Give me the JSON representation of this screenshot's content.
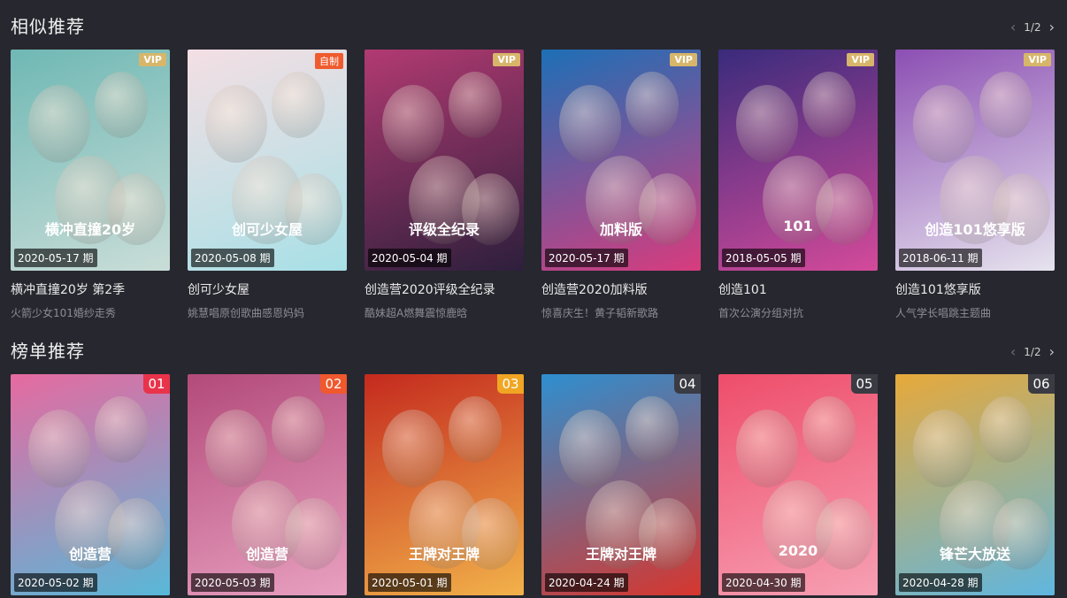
{
  "similar": {
    "title": "相似推荐",
    "pager": "1/2",
    "items": [
      {
        "title": "横冲直撞20岁 第2季",
        "desc": "火箭少女101婚纱走秀",
        "date": "2020-05-17 期",
        "badge": "VIP",
        "badge_type": "vip",
        "bg": "#6fb8b4",
        "bg2": "#c9ddd8",
        "art_text": "横冲直撞20岁"
      },
      {
        "title": "创可少女屋",
        "desc": "姚慧唱原创歌曲感恩妈妈",
        "date": "2020-05-08 期",
        "badge": "自制",
        "badge_type": "self",
        "bg": "#f4dfe4",
        "bg2": "#a7e0e6",
        "art_text": "创可少女屋"
      },
      {
        "title": "创造营2020评级全纪录",
        "desc": "酷妹超A燃舞震惊鹿晗",
        "date": "2020-05-04 期",
        "badge": "VIP",
        "badge_type": "vip",
        "bg": "#b23a72",
        "bg2": "#2d1f3c",
        "art_text": "评级全纪录"
      },
      {
        "title": "创造营2020加料版",
        "desc": "惊喜庆生！黄子韬新歌路",
        "date": "2020-05-17 期",
        "badge": "VIP",
        "badge_type": "vip",
        "bg": "#1d6fb6",
        "bg2": "#d83c7e",
        "art_text": "加料版"
      },
      {
        "title": "创造101",
        "desc": "首次公演分组对抗",
        "date": "2018-05-05 期",
        "badge": "VIP",
        "badge_type": "vip",
        "bg": "#3a2b7c",
        "bg2": "#d44a9a",
        "art_text": "101"
      },
      {
        "title": "创造101悠享版",
        "desc": "人气学长唱跳主题曲",
        "date": "2018-06-11 期",
        "badge": "VIP",
        "badge_type": "vip",
        "bg": "#8c4fb3",
        "bg2": "#e6e3ee",
        "art_text": "创造101悠享版"
      }
    ]
  },
  "ranking": {
    "title": "榜单推荐",
    "pager": "1/2",
    "items": [
      {
        "rank": "01",
        "date": "2020-05-02 期",
        "rank_color": "#e8334a",
        "bg": "#e66aa0",
        "bg2": "#58b8d8",
        "art_text": "创造营"
      },
      {
        "rank": "02",
        "date": "2020-05-03 期",
        "rank_color": "#f0582e",
        "bg": "#b34a7a",
        "bg2": "#e8a0c0",
        "art_text": "创造营"
      },
      {
        "rank": "03",
        "date": "2020-05-01 期",
        "rank_color": "#f0a623",
        "bg": "#c42a1e",
        "bg2": "#f2b24a",
        "art_text": "王牌对王牌"
      },
      {
        "rank": "04",
        "date": "2020-04-24 期",
        "rank_color": "#3b3b43",
        "bg": "#2e8fd0",
        "bg2": "#d7362e",
        "art_text": "王牌对王牌"
      },
      {
        "rank": "05",
        "date": "2020-04-30 期",
        "rank_color": "#3b3b43",
        "bg": "#ee4d6a",
        "bg2": "#f7a0b4",
        "art_text": "2020"
      },
      {
        "rank": "06",
        "date": "2020-04-28 期",
        "rank_color": "#3b3b43",
        "bg": "#e7a93a",
        "bg2": "#5fb6e0",
        "art_text": "锋芒大放送"
      }
    ]
  },
  "icons": {
    "prev": "chevron-left-icon",
    "next": "chevron-right-icon"
  }
}
